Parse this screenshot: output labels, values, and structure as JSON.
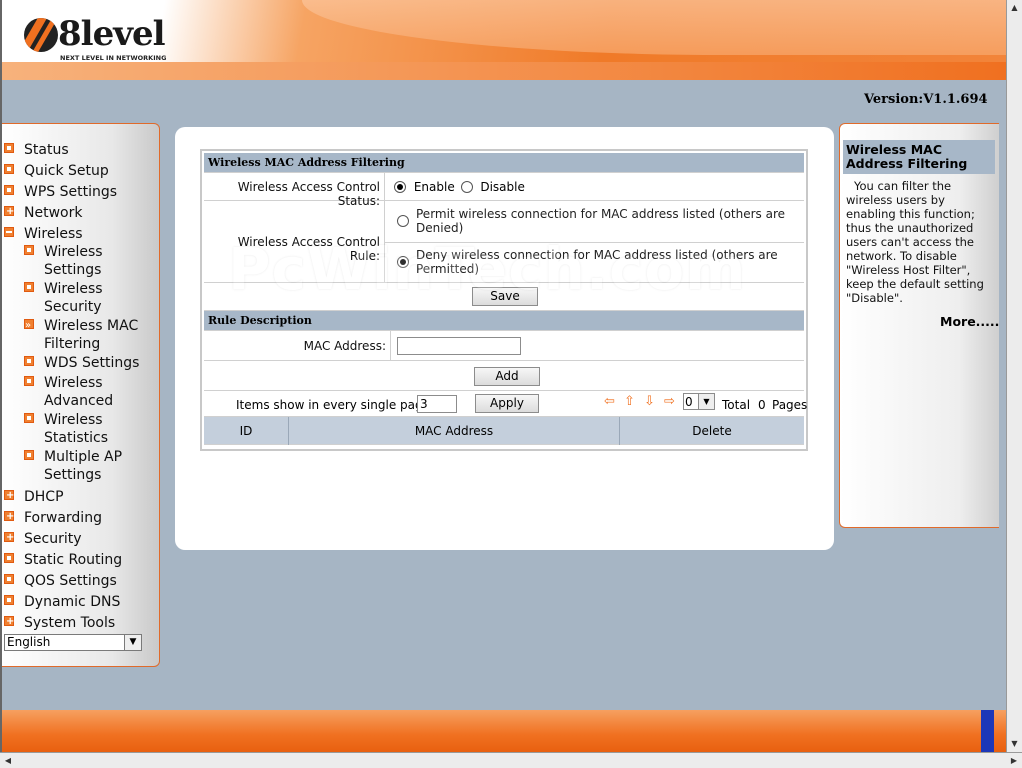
{
  "brand": {
    "logo_word": "8level",
    "tagline": "NEXT LEVEL IN NETWORKING"
  },
  "version": "Version:V1.1.694",
  "nav": {
    "items": [
      {
        "label": "Status",
        "icon": "square"
      },
      {
        "label": "Quick Setup",
        "icon": "square"
      },
      {
        "label": "WPS Settings",
        "icon": "square"
      },
      {
        "label": "Network",
        "icon": "plus"
      },
      {
        "label": "Wireless",
        "icon": "minus"
      },
      {
        "label": "Wireless Settings",
        "icon": "square",
        "sub": true
      },
      {
        "label": "Wireless Security",
        "icon": "square",
        "sub": true
      },
      {
        "label": "Wireless MAC Filtering",
        "icon": "arrow",
        "sub": true,
        "active": true
      },
      {
        "label": "WDS Settings",
        "icon": "square",
        "sub": true
      },
      {
        "label": "Wireless Advanced",
        "icon": "square",
        "sub": true
      },
      {
        "label": "Wireless Statistics",
        "icon": "square",
        "sub": true
      },
      {
        "label": "Multiple AP Settings",
        "icon": "square",
        "sub": true
      },
      {
        "label": "DHCP",
        "icon": "plus"
      },
      {
        "label": "Forwarding",
        "icon": "plus"
      },
      {
        "label": "Security",
        "icon": "plus"
      },
      {
        "label": "Static Routing",
        "icon": "square"
      },
      {
        "label": "QOS Settings",
        "icon": "square"
      },
      {
        "label": "Dynamic DNS",
        "icon": "square"
      },
      {
        "label": "System Tools",
        "icon": "plus"
      }
    ],
    "language": "English"
  },
  "form": {
    "section_title": "Wireless MAC Address Filtering",
    "status_label": "Wireless Access Control Status:",
    "enable_label": "Enable",
    "disable_label": "Disable",
    "status_value": "Enable",
    "rule_label": "Wireless Access Control Rule:",
    "permit_text": "Permit wireless connection for MAC address listed (others are Denied)",
    "deny_text": "Deny wireless connection for MAC address listed (others are Permitted)",
    "rule_value": "Deny",
    "save_label": "Save",
    "rule_section_title": "Rule Description",
    "mac_label": "MAC Address:",
    "mac_value": "",
    "add_label": "Add",
    "items_label": "Items show in every single page",
    "items_value": "3",
    "apply_label": "Apply",
    "page_select": "0",
    "total_label": "Total",
    "total_value": "0",
    "pages_label": "Pages",
    "columns": [
      "ID",
      "MAC Address",
      "Delete"
    ]
  },
  "watermark": "PcWinTech.com",
  "help": {
    "title": "Wireless MAC Address Filtering",
    "body": "You can filter the wireless users by enabling this function; thus the unauthorized users can't access the network. To disable \"Wireless Host Filter\", keep the default setting \"Disable\".",
    "more": "More....."
  },
  "colors": {
    "accent": "#f07020",
    "section": "#a7b7c8",
    "background": "#a6b5c4",
    "corner": "#1c37b8"
  }
}
